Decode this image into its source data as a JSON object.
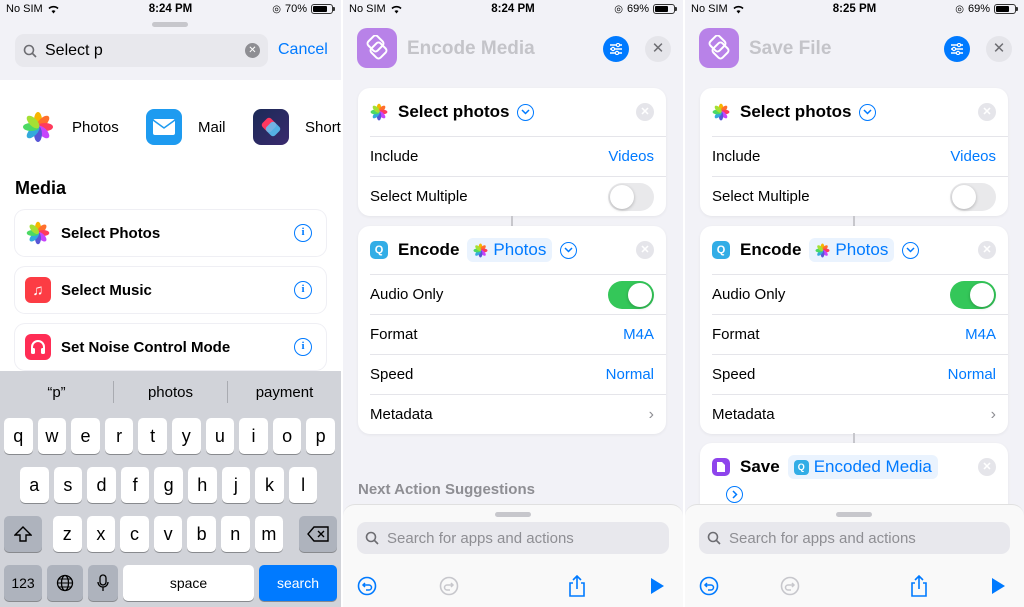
{
  "panel1": {
    "status": {
      "carrier": "No SIM",
      "time": "8:24 PM",
      "battery": "70%"
    },
    "search": {
      "value": "Select p",
      "cancel": "Cancel"
    },
    "apps": [
      {
        "label": "Photos",
        "icon": "photos-app-icon"
      },
      {
        "label": "Mail",
        "icon": "mail-app-icon"
      },
      {
        "label": "Short",
        "icon": "shortcuts-app-icon"
      }
    ],
    "section_title": "Media",
    "actions": [
      {
        "label": "Select Photos",
        "icon": "photos-icon"
      },
      {
        "label": "Select Music",
        "icon": "music-icon"
      },
      {
        "label": "Set Noise Control Mode",
        "icon": "headphones-icon"
      }
    ],
    "keyboard": {
      "predictions": [
        "“p”",
        "photos",
        "payment"
      ],
      "row1": [
        "q",
        "w",
        "e",
        "r",
        "t",
        "y",
        "u",
        "i",
        "o",
        "p"
      ],
      "row2": [
        "a",
        "s",
        "d",
        "f",
        "g",
        "h",
        "j",
        "k",
        "l"
      ],
      "row3": [
        "z",
        "x",
        "c",
        "v",
        "b",
        "n",
        "m"
      ],
      "numbers": "123",
      "space": "space",
      "search": "search"
    }
  },
  "panel2": {
    "status": {
      "carrier": "No SIM",
      "time": "8:24 PM",
      "battery": "69%"
    },
    "title": "Encode Media",
    "select_card": {
      "verb": "Select photos",
      "include_label": "Include",
      "include_value": "Videos",
      "multiple_label": "Select Multiple",
      "multiple_on": false
    },
    "encode_card": {
      "verb": "Encode",
      "var": "Photos",
      "audio_label": "Audio Only",
      "audio_on": true,
      "format_label": "Format",
      "format_value": "M4A",
      "speed_label": "Speed",
      "speed_value": "Normal",
      "metadata_label": "Metadata"
    },
    "next_suggestions": "Next Action Suggestions",
    "bottom_search": "Search for apps and actions"
  },
  "panel3": {
    "status": {
      "carrier": "No SIM",
      "time": "8:25 PM",
      "battery": "69%"
    },
    "title": "Save File",
    "select_card": {
      "verb": "Select photos",
      "include_label": "Include",
      "include_value": "Videos",
      "multiple_label": "Select Multiple",
      "multiple_on": false
    },
    "encode_card": {
      "verb": "Encode",
      "var": "Photos",
      "audio_label": "Audio Only",
      "audio_on": true,
      "format_label": "Format",
      "format_value": "M4A",
      "speed_label": "Speed",
      "speed_value": "Normal",
      "metadata_label": "Metadata"
    },
    "save_card": {
      "verb": "Save",
      "var": "Encoded Media"
    },
    "bottom_search": "Search for apps and actions"
  },
  "colors": {
    "accent": "#007aff",
    "toggle_on": "#34c759",
    "shortcut_purple": "#b882e8"
  }
}
